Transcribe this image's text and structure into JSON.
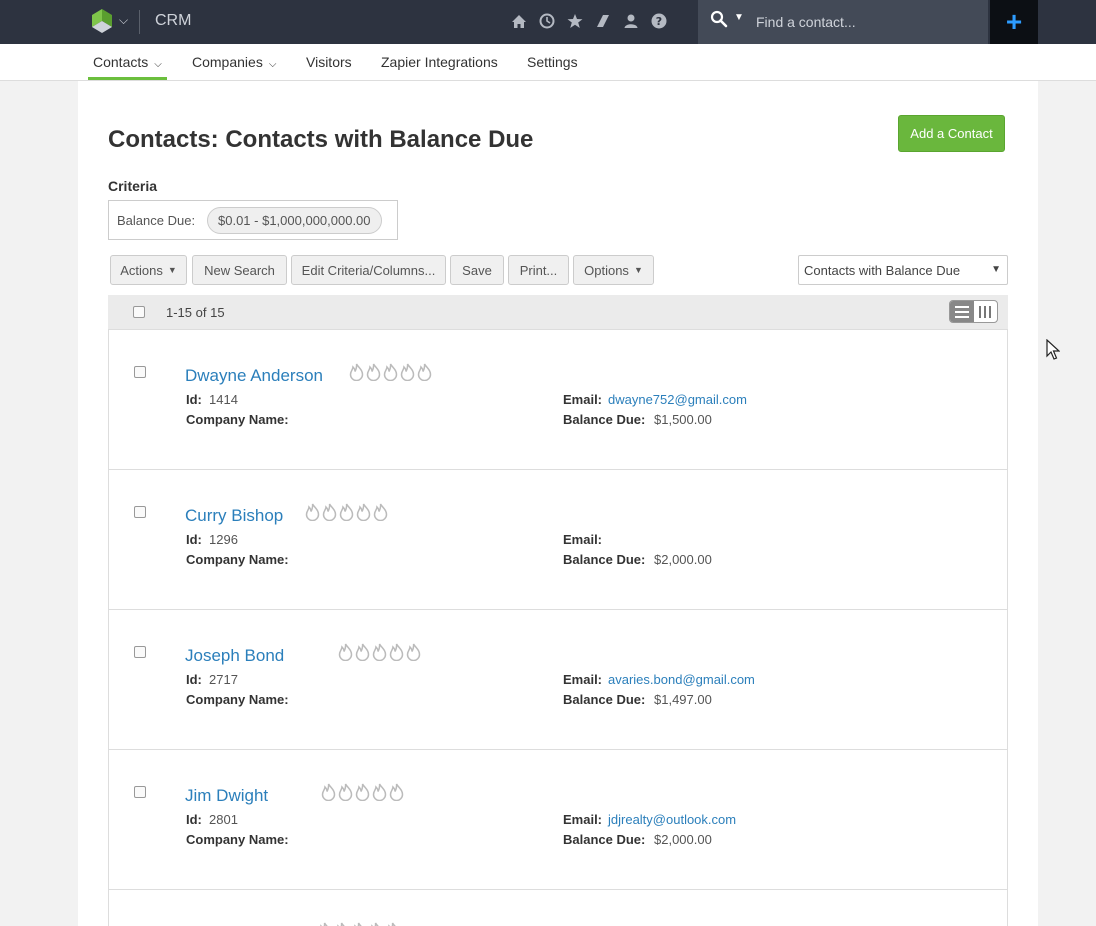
{
  "topbar": {
    "app_title": "CRM",
    "search_placeholder": "Find a contact...",
    "icons": [
      "home-icon",
      "history-icon",
      "star-icon",
      "zapier-icon",
      "user-icon",
      "help-icon"
    ],
    "add_label": "+"
  },
  "nav": {
    "items": [
      {
        "label": "Contacts",
        "has_caret": true,
        "active": true
      },
      {
        "label": "Companies",
        "has_caret": true,
        "active": false
      },
      {
        "label": "Visitors",
        "has_caret": false,
        "active": false
      },
      {
        "label": "Zapier Integrations",
        "has_caret": false,
        "active": false
      },
      {
        "label": "Settings",
        "has_caret": false,
        "active": false
      }
    ]
  },
  "page": {
    "title": "Contacts: Contacts with Balance Due",
    "add_contact_label": "Add a Contact",
    "criteria_heading": "Criteria",
    "criteria_label": "Balance Due:",
    "criteria_value": "$0.01 - $1,000,000,000.00"
  },
  "toolbar": {
    "actions_label": "Actions",
    "new_search_label": "New Search",
    "edit_criteria_label": "Edit Criteria/Columns...",
    "save_label": "Save",
    "print_label": "Print...",
    "options_label": "Options",
    "view_select_value": "Contacts with Balance Due"
  },
  "list": {
    "count_label": "1-15 of 15",
    "field_labels": {
      "id": "Id:",
      "company": "Company Name:",
      "email": "Email:",
      "balance": "Balance Due:"
    },
    "contacts": [
      {
        "name": "Dwayne Anderson",
        "id": "1414",
        "company": "",
        "email": "dwayne752@gmail.com",
        "balance": "$1,500.00"
      },
      {
        "name": "Curry Bishop",
        "id": "1296",
        "company": "",
        "email": "",
        "balance": "$2,000.00"
      },
      {
        "name": "Joseph Bond",
        "id": "2717",
        "company": "",
        "email": "avaries.bond@gmail.com",
        "balance": "$1,497.00"
      },
      {
        "name": "Jim Dwight",
        "id": "2801",
        "company": "",
        "email": "jdjrealty@outlook.com",
        "balance": "$2,000.00"
      }
    ]
  },
  "colors": {
    "topbar": "#2d3340",
    "accent_green": "#6ab73d",
    "link_blue": "#2b7fbb"
  }
}
